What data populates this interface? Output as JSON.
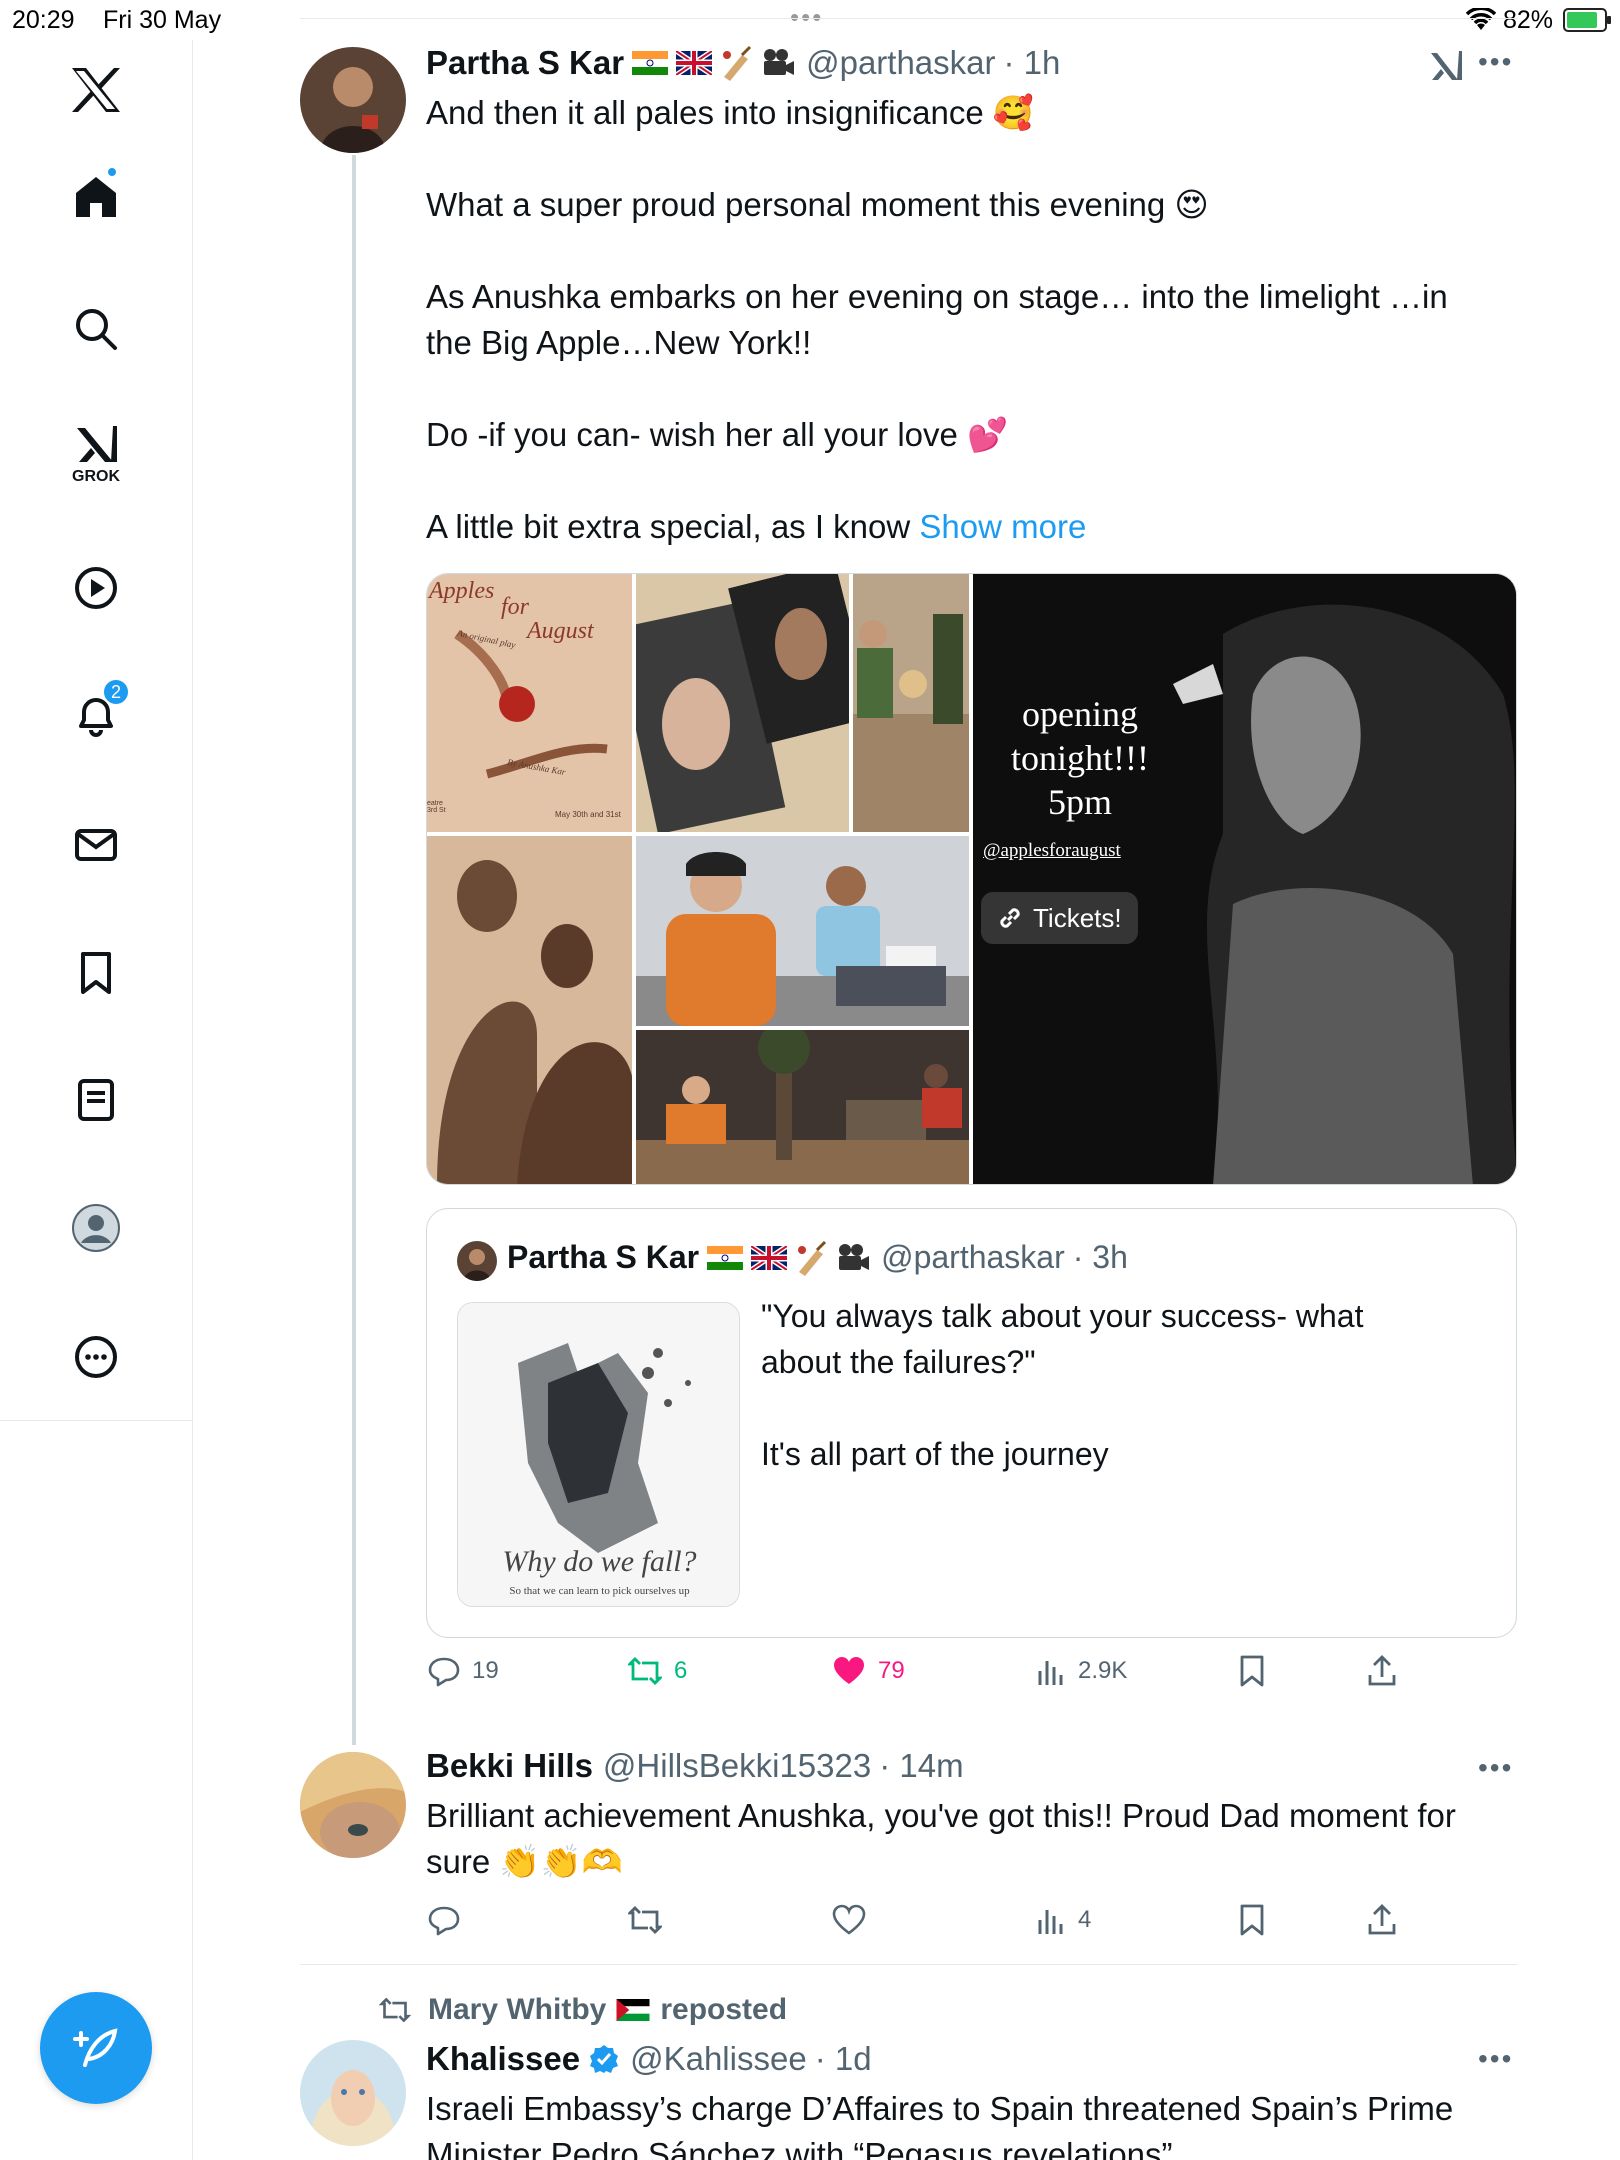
{
  "status_bar": {
    "time": "20:29",
    "date": "Fri 30 May",
    "battery_percent": "82%",
    "battery_level": 0.82
  },
  "sidebar": {
    "items": [
      {
        "name": "x-logo-icon"
      },
      {
        "name": "home-icon",
        "has_dot": true
      },
      {
        "name": "search-icon"
      },
      {
        "name": "grok-icon",
        "label": "GROK"
      },
      {
        "name": "video-icon"
      },
      {
        "name": "notifications-icon",
        "badge": "2"
      },
      {
        "name": "messages-icon"
      },
      {
        "name": "bookmarks-icon"
      },
      {
        "name": "lists-icon"
      },
      {
        "name": "profile-icon"
      },
      {
        "name": "more-icon"
      }
    ],
    "accent": "#1d9bf0"
  },
  "main_tweet": {
    "name": "Partha S Kar",
    "handle": "@parthaskar",
    "time": "· 1h",
    "text": "And then it all pales into insignificance 🥰\n\nWhat a super proud personal moment this evening 😍\n\nAs Anushka embarks on her evening on stage… into the limelight …in\nthe Big Apple…New York!!\n\nDo -if you can- wish her all your love 💕\n\nA little bit extra special, as I know ",
    "show_more": "Show more",
    "media": {
      "poster_title_1": "Apples",
      "poster_title_2": "for",
      "poster_title_3": "August",
      "poster_subtitle": "An original play",
      "poster_by": "By Anushka Kar",
      "poster_dates": "May 30th and 31st",
      "poster_side": "eatre\n3rd St",
      "opening_line1": "opening",
      "opening_line2": "tonight!!!",
      "opening_line3": "5pm",
      "opening_handle": "@applesforaugust",
      "tickets_label": "Tickets!"
    },
    "quote": {
      "name": "Partha S Kar",
      "handle": "@parthaskar",
      "time": "· 3h",
      "text": "\"You always talk about your success- what\nabout the failures?\"\n\nIt's all part of the journey",
      "thumb_title": "Why do we fall?",
      "thumb_caption": "So that we can learn to pick ourselves up"
    },
    "actions": {
      "replies": "19",
      "reposts": "6",
      "likes": "79",
      "views": "2.9K"
    },
    "colors": {
      "repost": "#00ba7c",
      "like": "#f91880"
    }
  },
  "reply_tweet": {
    "name": "Bekki Hills",
    "handle": "@HillsBekki15323",
    "time": "· 14m",
    "text": "Brilliant achievement Anushka, you've got this!! Proud Dad moment for\nsure 👏👏🫶",
    "actions": {
      "views": "4"
    }
  },
  "next_tweet": {
    "repost_by": "Mary Whitby",
    "repost_suffix": "reposted",
    "name": "Khalissee",
    "handle": "@Kahlissee",
    "time": "· 1d",
    "text": "Israeli Embassy’s charge D’Affaires to Spain threatened Spain’s Prime\nMinister Pedro Sánchez with “Pegasus revelations”"
  }
}
